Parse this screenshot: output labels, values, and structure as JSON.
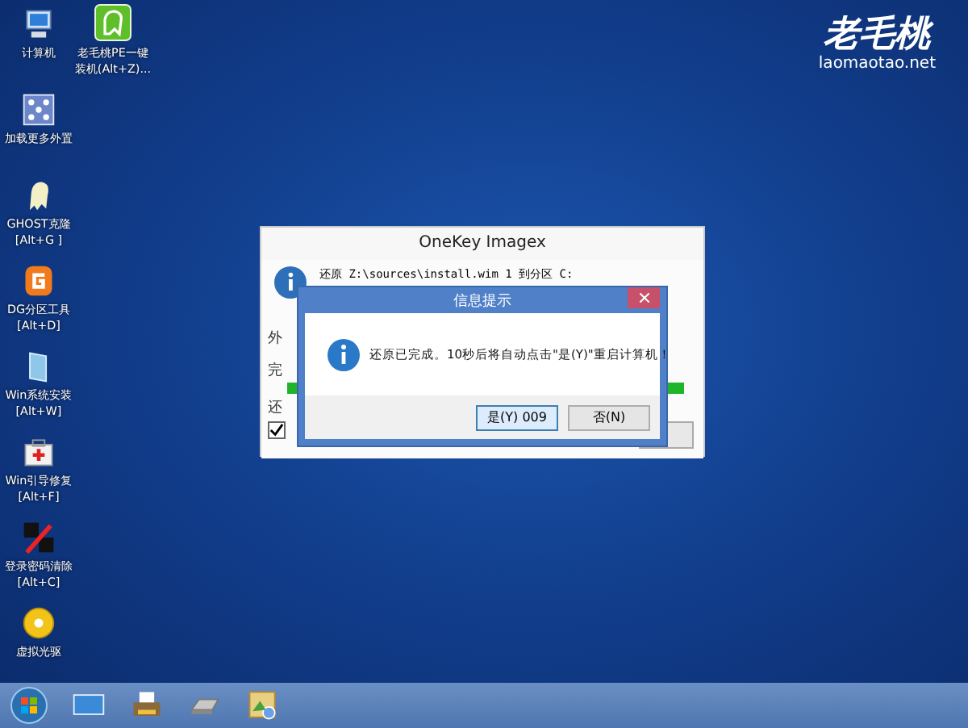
{
  "desktop_icons": [
    {
      "kind": "computer",
      "label": [
        "计算机"
      ]
    },
    {
      "kind": "plugin",
      "label": [
        "加载更多外置"
      ]
    },
    {
      "kind": "ghost",
      "label": [
        "GHOST克隆",
        "[Alt+G ]"
      ]
    },
    {
      "kind": "partition",
      "label": [
        "DG分区工具",
        "[Alt+D]"
      ]
    },
    {
      "kind": "install",
      "label": [
        "Win系统安装",
        "[Alt+W]"
      ]
    },
    {
      "kind": "repair",
      "label": [
        "Win引导修复",
        "[Alt+F]"
      ]
    },
    {
      "kind": "password",
      "label": [
        "登录密码清除",
        "[Alt+C]"
      ]
    },
    {
      "kind": "disc",
      "label": [
        "虚拟光驱"
      ]
    }
  ],
  "pinned_icon": {
    "kind": "installer",
    "label": [
      "老毛桃PE一键",
      "装机(Alt+Z)..."
    ]
  },
  "logo": {
    "title": "老毛桃",
    "url": "laomaotao.net"
  },
  "back_window": {
    "title": "OneKey Imagex",
    "message": "还原 Z:\\sources\\install.wim 1 到分区 C:",
    "label_1": "外",
    "label_2": "完",
    "label_3": "还",
    "progress": {
      "level": 1
    },
    "checkbox": {
      "checked": true
    }
  },
  "dialog": {
    "title": "信息提示",
    "message": "还原已完成。10秒后将自动点击\"是(Y)\"重启计算机！",
    "buttons": [
      {
        "label": "是(Y) 009",
        "selected": true
      },
      {
        "label": "否(N)",
        "selected": false
      }
    ]
  },
  "taskbar": {
    "icons": [
      {
        "kind": "monitor"
      },
      {
        "kind": "printer"
      },
      {
        "kind": "drive"
      },
      {
        "kind": "picture"
      }
    ]
  }
}
